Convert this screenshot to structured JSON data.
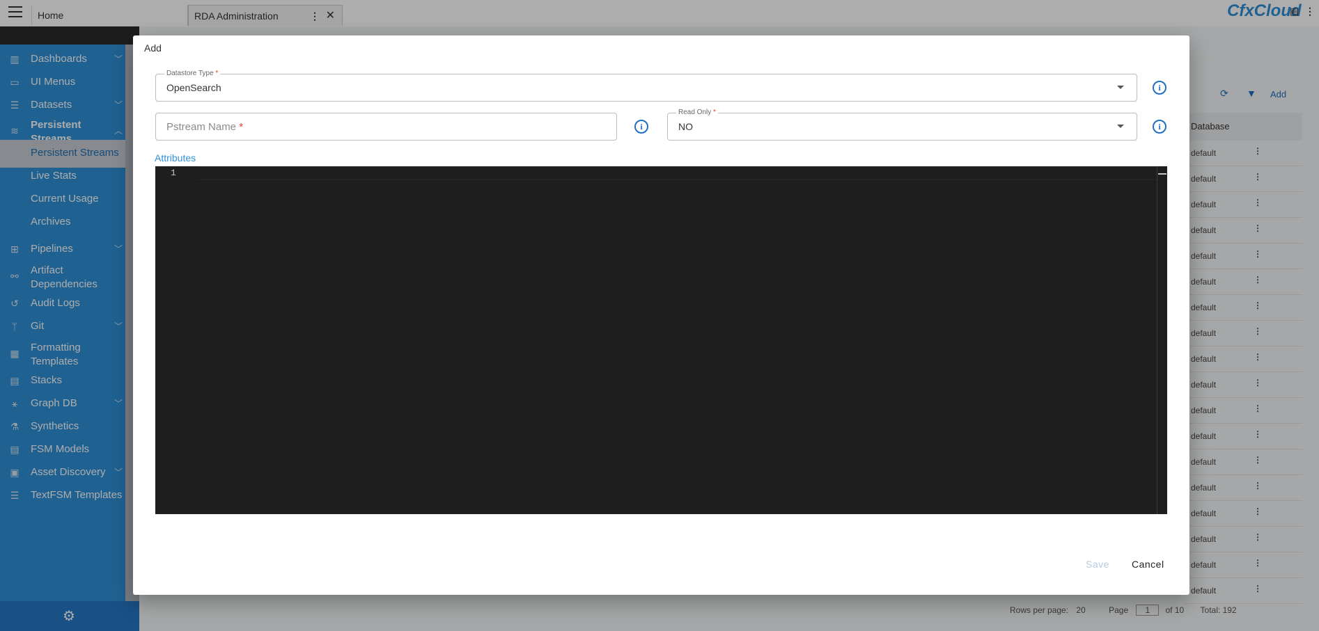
{
  "tabs": [
    {
      "label": "Home"
    },
    {
      "label": "RDA Administration"
    }
  ],
  "logo": "CfxCloud",
  "sidebar": {
    "items": [
      {
        "label": "Dashboards",
        "icon": "chart-icon",
        "expandable": true
      },
      {
        "label": "UI Menus",
        "icon": "terminal-icon",
        "expandable": false
      },
      {
        "label": "Datasets",
        "icon": "database-icon",
        "expandable": true
      },
      {
        "label": "Persistent",
        "label2": "Streams",
        "icon": "streams-icon",
        "expandable": true,
        "expanded": true
      },
      {
        "label": "Pipelines",
        "icon": "pipeline-icon",
        "expandable": true
      },
      {
        "label": "Artifact",
        "label2": "Dependencies",
        "icon": "dependencies-icon",
        "expandable": false
      },
      {
        "label": "Audit Logs",
        "icon": "history-icon",
        "expandable": false
      },
      {
        "label": "Git",
        "icon": "git-icon",
        "expandable": true
      },
      {
        "label": "Formatting",
        "label2": "Templates",
        "icon": "templates-icon",
        "expandable": false
      },
      {
        "label": "Stacks",
        "icon": "stacks-icon",
        "expandable": false
      },
      {
        "label": "Graph DB",
        "icon": "graph-icon",
        "expandable": true
      },
      {
        "label": "Synthetics",
        "icon": "flask-icon",
        "expandable": false
      },
      {
        "label": "FSM Models",
        "icon": "document-icon",
        "expandable": false
      },
      {
        "label": "Asset Discovery",
        "icon": "asset-icon",
        "expandable": true
      },
      {
        "label": "TextFSM Templates",
        "icon": "list-icon",
        "expandable": false
      }
    ],
    "subitems": [
      {
        "label": "Persistent Streams",
        "active": true
      },
      {
        "label": "Live Stats"
      },
      {
        "label": "Current Usage"
      },
      {
        "label": "Archives"
      }
    ]
  },
  "background": {
    "toolbar_add": "Add",
    "column_header": "Database",
    "rows": [
      "default",
      "default",
      "default",
      "default",
      "default",
      "default",
      "default",
      "default",
      "default",
      "default",
      "default",
      "default",
      "default",
      "default",
      "default",
      "default",
      "default",
      "default"
    ],
    "pager": {
      "rows_per_page_label": "Rows per page:",
      "rows_per_page": "20",
      "page_label": "Page",
      "page": "1",
      "of": "of 10",
      "total": "Total: 192"
    }
  },
  "modal": {
    "title": "Add",
    "datastore_type": {
      "label": "Datastore Type",
      "value": "OpenSearch"
    },
    "pstream_name": {
      "placeholder": "Pstream Name"
    },
    "read_only": {
      "label": "Read Only",
      "value": "NO"
    },
    "required_mark": "*",
    "attributes_label": "Attributes",
    "editor": {
      "line_number": "1"
    },
    "save_label": "Save",
    "cancel_label": "Cancel"
  }
}
